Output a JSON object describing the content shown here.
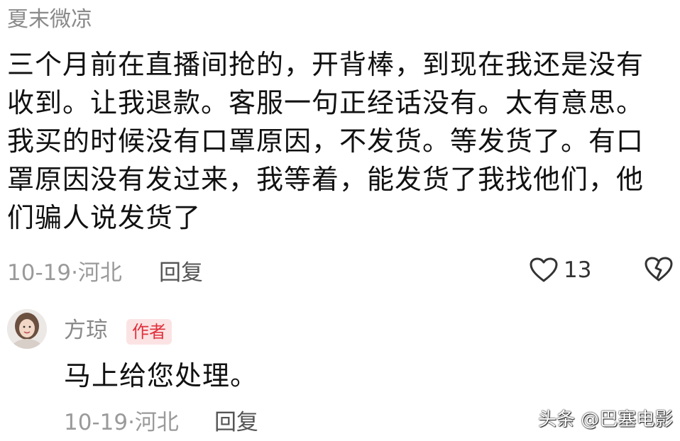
{
  "comment": {
    "username": "夏末微凉",
    "text": "三个月前在直播间抢的，开背棒，到现在我还是没有收到。让我退款。客服一句正经话没有。太有意思。我买的时候没有口罩原因，不发货。等发货了。有口罩原因没有发过来，我等着，能发货了我找他们，他们骗人说发货了",
    "date_location": "10-19·河北",
    "reply_label": "回复",
    "like_count": "13",
    "like_icon": "heart-outline-icon",
    "dislike_icon": "broken-heart-icon"
  },
  "author_reply": {
    "name": "方琼",
    "badge": "作者",
    "text": "马上给您处理。",
    "date_location": "10-19·河北",
    "reply_label": "回复",
    "avatar_icon": "avatar-photo"
  },
  "watermark": "头条 @巴塞电影",
  "colors": {
    "meta_gray": "#9a9a9a",
    "badge_red": "#e0313c",
    "badge_bg": "#fbe3e4"
  }
}
